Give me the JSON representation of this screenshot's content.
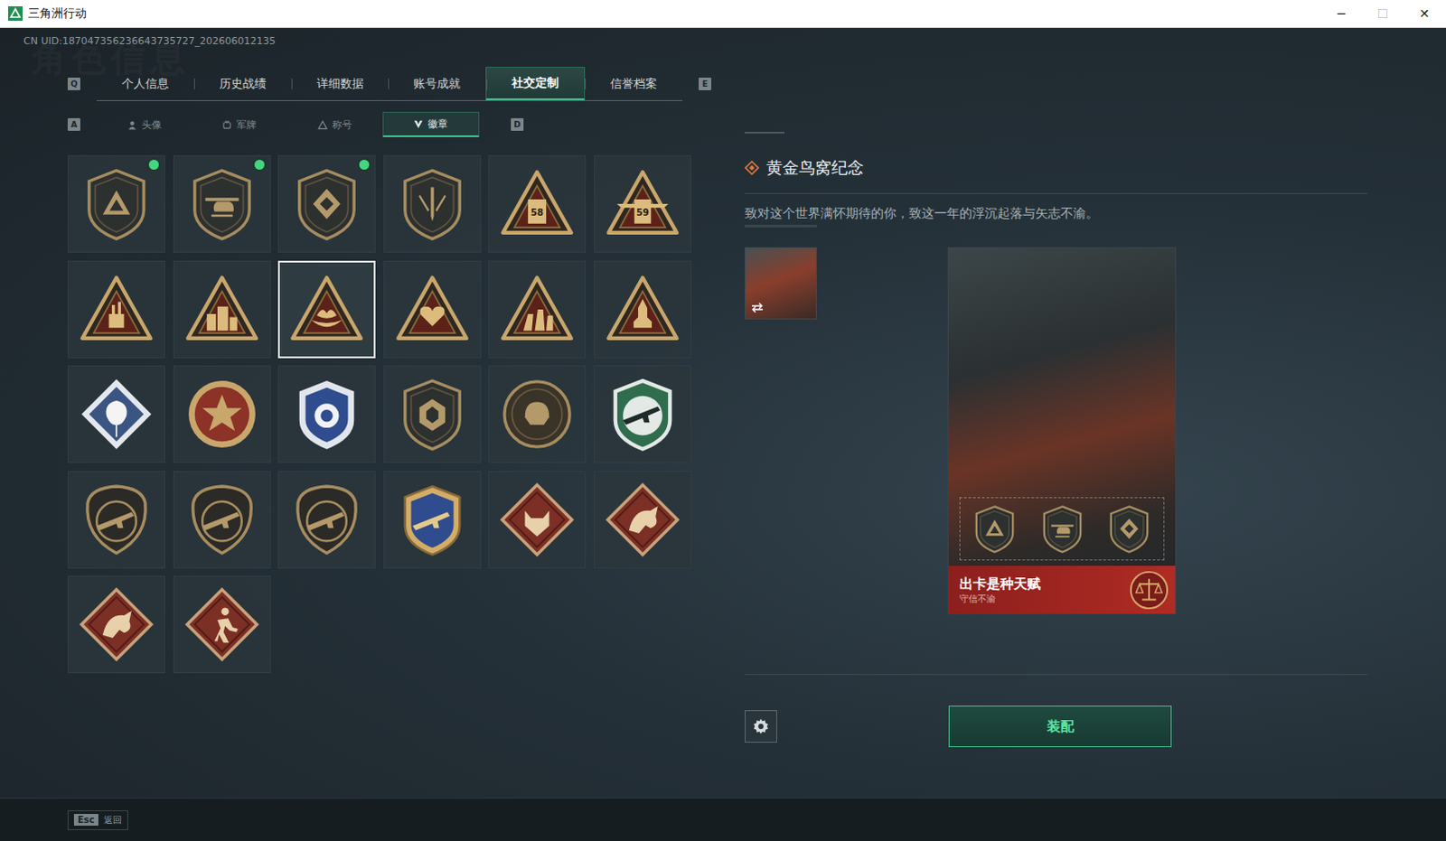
{
  "window": {
    "title": "三角洲行动",
    "controls": [
      {
        "glyph": "─",
        "disabled": false
      },
      {
        "glyph": "☐",
        "disabled": true
      },
      {
        "glyph": "✕",
        "disabled": false
      }
    ]
  },
  "uid": "CN UID:187047356236643735727_202606012135",
  "page_title": "角色信息",
  "tabs": {
    "prev_key": "Q",
    "next_key": "E",
    "items": [
      {
        "label": "个人信息",
        "selected": false
      },
      {
        "label": "历史战绩",
        "selected": false
      },
      {
        "label": "详细数据",
        "selected": false
      },
      {
        "label": "账号成就",
        "selected": false
      },
      {
        "label": "社交定制",
        "selected": true
      },
      {
        "label": "信誉档案",
        "selected": false
      }
    ]
  },
  "subtabs": {
    "prev_key": "A",
    "next_key": "D",
    "items": [
      {
        "label": "头像",
        "kind": "avatar",
        "selected": false
      },
      {
        "label": "军牌",
        "kind": "dogtag",
        "selected": false
      },
      {
        "label": "称号",
        "kind": "title",
        "selected": false
      },
      {
        "label": "徽章",
        "kind": "badge",
        "selected": true
      }
    ]
  },
  "badges": [
    {
      "kind": "shield-delta",
      "mark": "",
      "new": true,
      "selected": false
    },
    {
      "kind": "shield-heli",
      "mark": "",
      "new": true,
      "selected": false
    },
    {
      "kind": "shield-core",
      "mark": "",
      "new": true,
      "selected": false
    },
    {
      "kind": "shield-blade",
      "mark": "",
      "new": false,
      "selected": false
    },
    {
      "kind": "tri-truck",
      "mark": "58",
      "new": false,
      "selected": false
    },
    {
      "kind": "tri-wings",
      "mark": "59",
      "new": false,
      "selected": false
    },
    {
      "kind": "tri-hand",
      "mark": "",
      "new": false,
      "selected": false
    },
    {
      "kind": "tri-city",
      "mark": "",
      "new": false,
      "selected": false
    },
    {
      "kind": "tri-nest",
      "mark": "",
      "new": false,
      "selected": true
    },
    {
      "kind": "tri-heart",
      "mark": "",
      "new": false,
      "selected": false
    },
    {
      "kind": "tri-squad",
      "mark": "",
      "new": false,
      "selected": false
    },
    {
      "kind": "tri-rocket",
      "mark": "",
      "new": false,
      "selected": false
    },
    {
      "kind": "rose",
      "mark": "",
      "new": false,
      "selected": false
    },
    {
      "kind": "star",
      "mark": "",
      "new": false,
      "selected": false
    },
    {
      "kind": "police",
      "mark": "",
      "new": false,
      "selected": false
    },
    {
      "kind": "gem",
      "mark": "",
      "new": false,
      "selected": false
    },
    {
      "kind": "round",
      "mark": "",
      "new": false,
      "selected": false
    },
    {
      "kind": "crest-green",
      "mark": "",
      "new": false,
      "selected": false
    },
    {
      "kind": "rifle",
      "mark": "",
      "new": false,
      "selected": false
    },
    {
      "kind": "rifle",
      "mark": "",
      "new": false,
      "selected": false
    },
    {
      "kind": "rifle",
      "mark": "",
      "new": false,
      "selected": false
    },
    {
      "kind": "crest-gold",
      "mark": "",
      "new": false,
      "selected": false
    },
    {
      "kind": "red-wolf",
      "mark": "",
      "new": false,
      "selected": false
    },
    {
      "kind": "red-dragon",
      "mark": "",
      "new": false,
      "selected": false
    },
    {
      "kind": "red-dragon",
      "mark": "",
      "new": false,
      "selected": false
    },
    {
      "kind": "red-runner",
      "mark": "",
      "new": false,
      "selected": false
    }
  ],
  "detail": {
    "title": "黄金鸟窝纪念",
    "description": "致对这个世界满怀期待的你，致这一年的浮沉起落与矢志不渝。",
    "card": {
      "title": "出卡是种天赋",
      "subtitle": "守信不渝",
      "slots": [
        "shield-delta",
        "shield-heli",
        "shield-core"
      ]
    }
  },
  "equip_button": "装配",
  "footer": {
    "key": "Esc",
    "label": "返回"
  }
}
